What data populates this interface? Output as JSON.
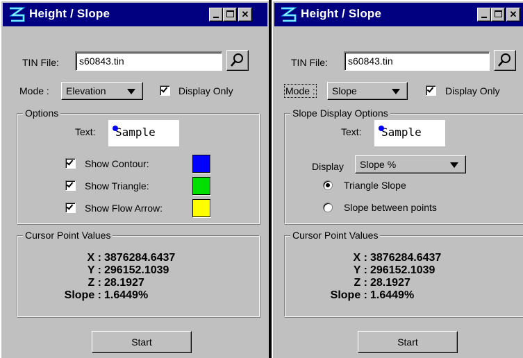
{
  "left_window": {
    "title": "Height / Slope",
    "tin_label": "TIN File:",
    "tin_value": "s60843.tin",
    "mode_label": "Mode :",
    "mode_value": "Elevation",
    "display_only_label": "Display Only",
    "display_only_checked": true,
    "options_title": "Options",
    "text_label": "Text:",
    "sample_text": "Sample",
    "show_contour_label": "Show Contour:",
    "show_triangle_label": "Show Triangle:",
    "show_flow_arrow_label": "Show Flow Arrow:",
    "contour_color": "#0000ff",
    "triangle_color": "#00e000",
    "flow_arrow_color": "#ffff00",
    "cursor_title": "Cursor Point Values",
    "x_label": "X :",
    "x_value": "3876284.6437",
    "y_label": "Y :",
    "y_value": "296152.1039",
    "z_label": "Z :",
    "z_value": "28.1927",
    "slope_label": "Slope :",
    "slope_value": "1.6449%",
    "start_label": "Start"
  },
  "right_window": {
    "title": "Height / Slope",
    "tin_label": "TIN File:",
    "tin_value": "s60843.tin",
    "mode_label": "Mode :",
    "mode_value": "Slope",
    "display_only_label": "Display Only",
    "display_only_checked": true,
    "options_title": "Slope Display Options",
    "text_label": "Text:",
    "sample_text": "Sample",
    "display_label": "Display",
    "display_value": "Slope %",
    "radio_triangle_label": "Triangle Slope",
    "radio_between_label": "Slope between points",
    "selected_radio": "Triangle Slope",
    "cursor_title": "Cursor Point Values",
    "x_label": "X :",
    "x_value": "3876284.6437",
    "y_label": "Y :",
    "y_value": "296152.1039",
    "z_label": "Z :",
    "z_value": "28.1927",
    "slope_label": "Slope :",
    "slope_value": "1.6449%",
    "start_label": "Start"
  },
  "colors": {
    "titlebar": "#000080",
    "dialog_bg": "#c0c0c0"
  }
}
